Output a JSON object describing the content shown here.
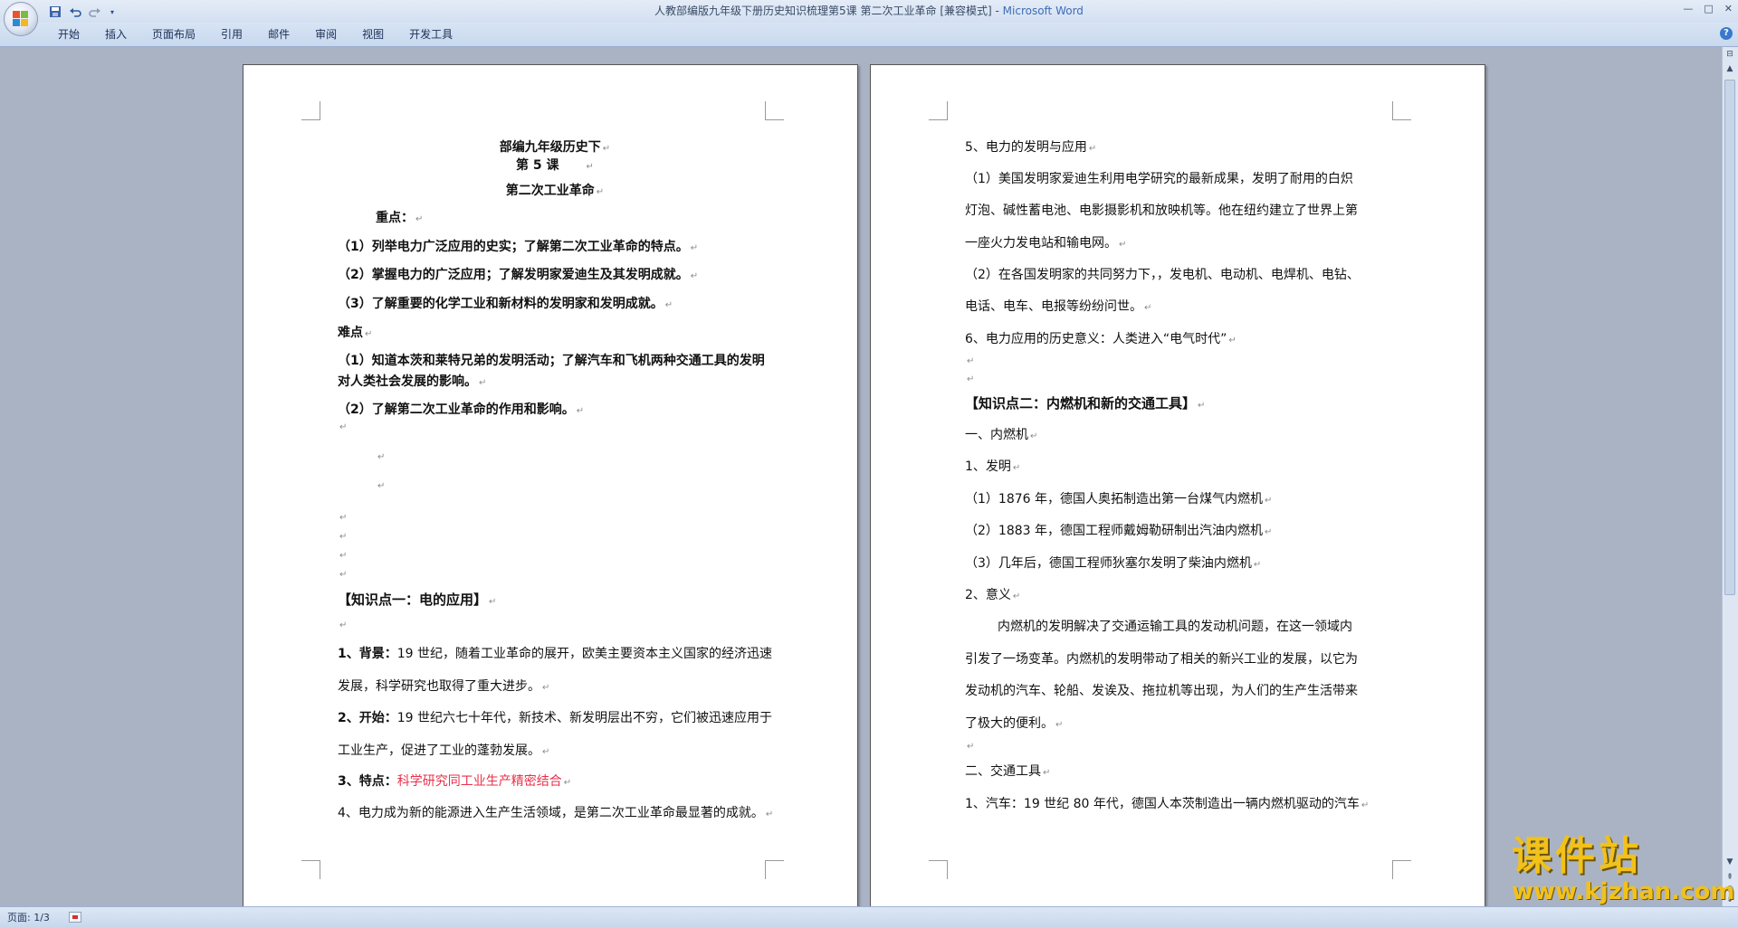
{
  "window": {
    "title": "人教部编版九年级下册历史知识梳理第5课 第二次工业革命 [兼容模式]",
    "title_sep": " - ",
    "app_name": "Microsoft Word",
    "controls": {
      "minimize": "—",
      "maximize": "□",
      "close": "✕"
    }
  },
  "quick_access": {
    "save_icon": "save-icon",
    "undo_icon": "undo-icon",
    "redo_icon": "redo-icon",
    "customize_icon": "customize-arrow-icon"
  },
  "ribbon": {
    "tabs": [
      "开始",
      "插入",
      "页面布局",
      "引用",
      "邮件",
      "审阅",
      "视图",
      "开发工具"
    ],
    "help": "?"
  },
  "page1": {
    "title": "部编九年级历史下",
    "lesson": "第 5 课",
    "subtitle": "第二次工业革命",
    "key_label": "重点：",
    "key_points": [
      "（1）列举电力广泛应用的史实；了解第二次工业革命的特点。",
      "（2）掌握电力的广泛应用；了解发明家爱迪生及其发明成就。",
      "（3）了解重要的化学工业和新材料的发明家和发明成就。"
    ],
    "difficult_label": "难点",
    "difficult_points": [
      "（1）知道本茨和莱特兄弟的发明活动；了解汽车和飞机两种交通工具的发明对人类社会发展的影响。",
      "（2）了解第二次工业革命的作用和影响。"
    ],
    "section1_heading": "【知识点一：电的应用】",
    "bg_label": "1、背景：",
    "bg_text": "19 世纪，随着工业革命的展开，欧美主要资本主义国家的经济迅速发展，科学研究也取得了重大进步。",
    "start_label": "2、开始：",
    "start_text": "19 世纪六七十年代，新技术、新发明层出不穷，它们被迅速应用于工业生产，促进了工业的蓬勃发展。",
    "feature_label": "3、特点：",
    "feature_text": "科学研究同工业生产精密结合",
    "item4_text": "4、电力成为新的能源进入生产生活领域，是第二次工业革命最显著的成就。"
  },
  "page2": {
    "lines": [
      "5、电力的发明与应用",
      "（1）美国发明家爱迪生利用电学研究的最新成果，发明了耐用的白炽",
      "灯泡、碱性蓄电池、电影摄影机和放映机等。他在纽约建立了世界上第",
      "一座火力发电站和输电网。",
      "（2）在各国发明家的共同努力下，，发电机、电动机、电焊机、电钻、",
      "电话、电车、电报等纷纷问世。",
      "6、电力应用的历史意义：人类进入“电气时代”"
    ],
    "section2_heading": "【知识点二：内燃机和新的交通工具】",
    "lines2": [
      "一、内燃机",
      "1、发明",
      "（1）1876 年，德国人奥拓制造出第一台煤气内燃机",
      "（2）1883 年，德国工程师戴姆勒研制出汽油内燃机",
      "（3）几年后，德国工程师狄塞尔发明了柴油内燃机",
      "2、意义",
      "内燃机的发明解决了交通运输工具的发动机问题，在这一领域内",
      "引发了一场变革。内燃机的发明带动了相关的新兴工业的发展，以它为",
      "发动机的汽车、轮船、发诶及、拖拉机等出现，为人们的生产生活带来",
      "了极大的便利。"
    ],
    "lines3": [
      "二、交通工具",
      "1、汽车：19 世纪 80 年代，德国人本茨制造出一辆内燃机驱动的汽车"
    ]
  },
  "para_mark": "↵",
  "status": {
    "page": "页面: 1/3"
  },
  "watermark": {
    "main": "课件站",
    "sub": "www.kjzhan.com"
  }
}
